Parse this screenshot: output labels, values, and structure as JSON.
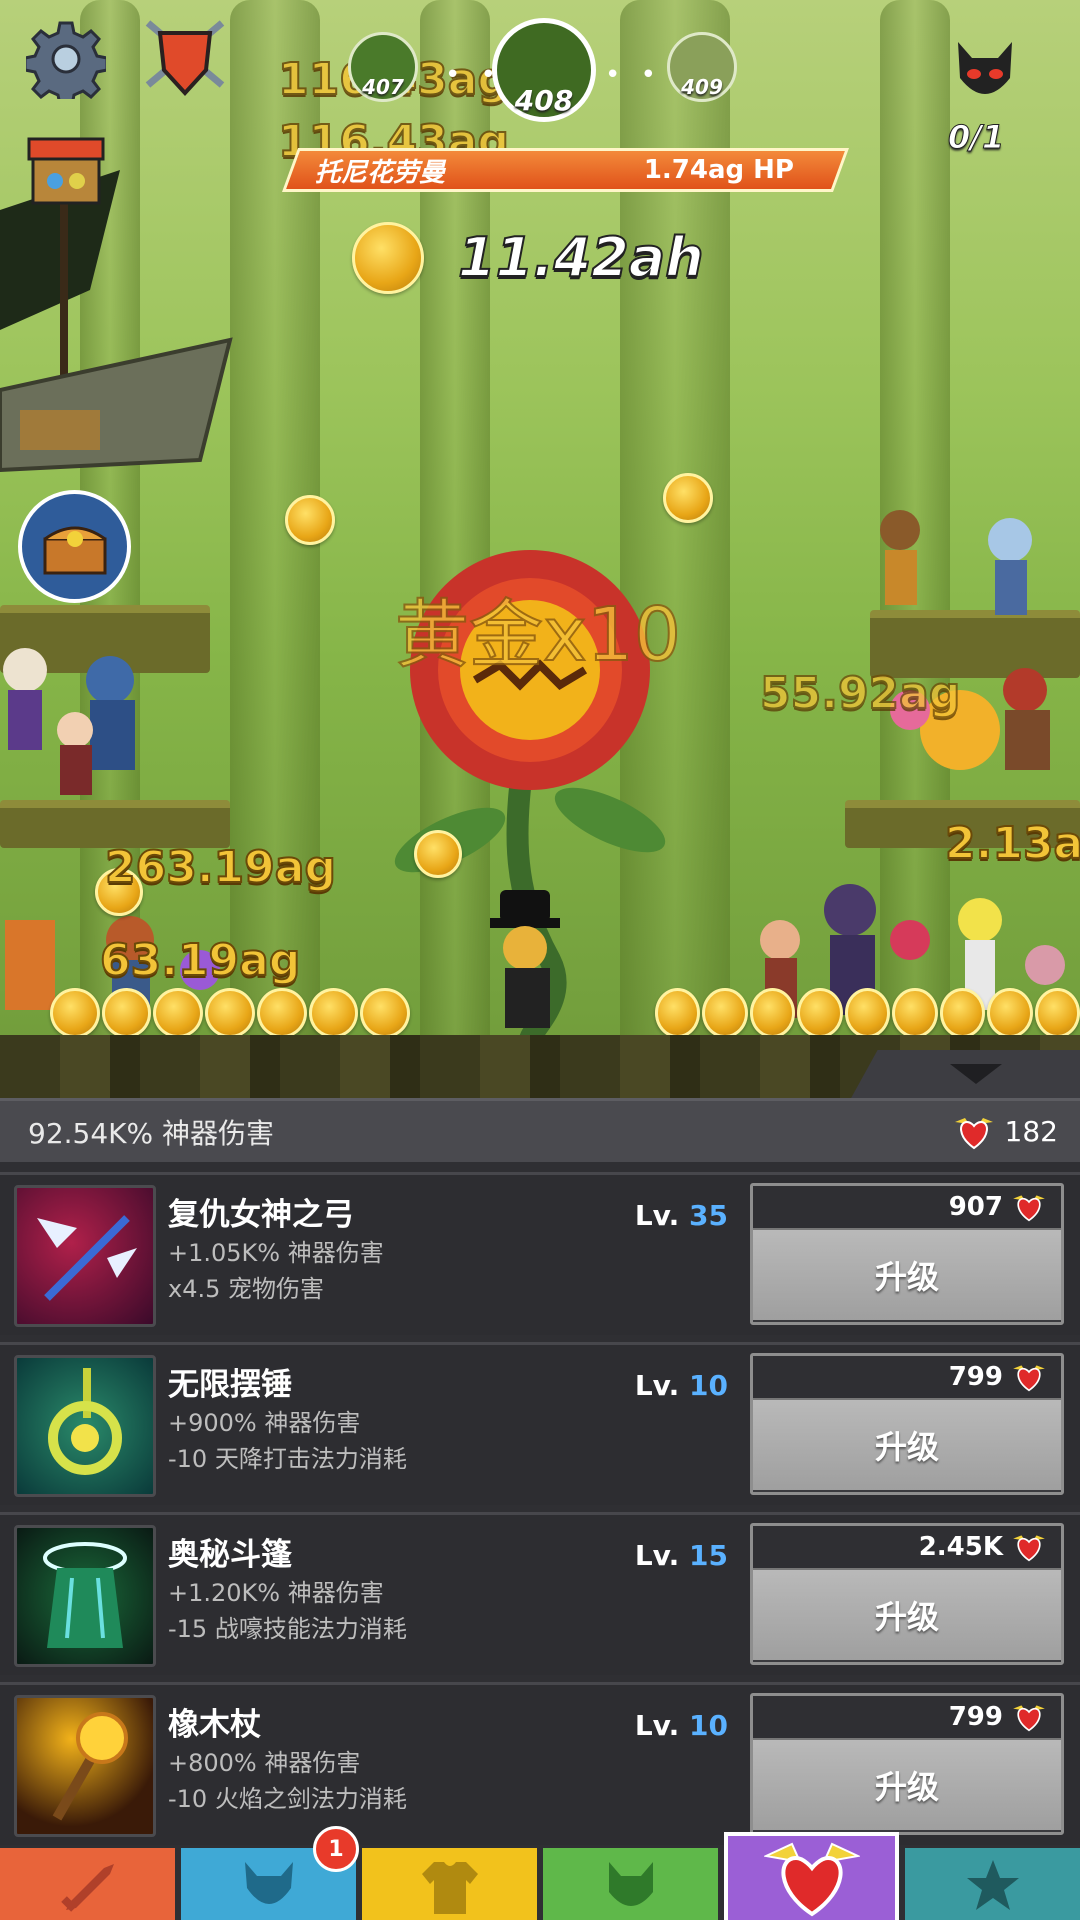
{
  "hud": {
    "stages": [
      {
        "label": "407"
      },
      {
        "label": "408"
      },
      {
        "label": "409"
      }
    ],
    "enemy_counter": "0/1",
    "boss_name": "托尼花劳曼",
    "boss_hp": "1.74ag HP",
    "gold": "11.42ah",
    "ghost_text_1": "116.43ag",
    "ghost_text_2": "116.43ag"
  },
  "battle": {
    "gold_bonus": "黄金x10",
    "damage_numbers": [
      "263.19ag",
      "63.19ag",
      "55.92ag",
      "2.13a"
    ]
  },
  "panel": {
    "total_damage": "92.54K% 神器伤害",
    "relic_count": "182",
    "level_prefix": "Lv.",
    "artifacts": [
      {
        "name": "复仇女神之弓",
        "line1": "+1.05K% 神器伤害",
        "line2": "x4.5 宠物伤害",
        "level": "35",
        "cost": "907",
        "button": "升级"
      },
      {
        "name": "无限摆锤",
        "line1": "+900% 神器伤害",
        "line2": "-10 天降打击法力消耗",
        "level": "10",
        "cost": "799",
        "button": "升级"
      },
      {
        "name": "奥秘斗篷",
        "line1": "+1.20K% 神器伤害",
        "line2": "-15 战嚎技能法力消耗",
        "level": "15",
        "cost": "2.45K",
        "button": "升级"
      },
      {
        "name": "橡木杖",
        "line1": "+800% 神器伤害",
        "line2": "-10 火焰之剑法力消耗",
        "level": "10",
        "cost": "799",
        "button": "升级"
      }
    ]
  },
  "bottom_nav": {
    "tabs": [
      {
        "icon": "sword-icon",
        "color": "#e8643a"
      },
      {
        "icon": "hero-helmet-icon",
        "color": "#3fa9d6",
        "badge": "1"
      },
      {
        "icon": "shirt-icon",
        "color": "#f2c21c"
      },
      {
        "icon": "pet-icon",
        "color": "#5fb84a"
      },
      {
        "icon": "artifact-heart-icon",
        "color": "#9b5fd6"
      },
      {
        "icon": "star-icon",
        "color": "#3a9aa0"
      }
    ]
  }
}
